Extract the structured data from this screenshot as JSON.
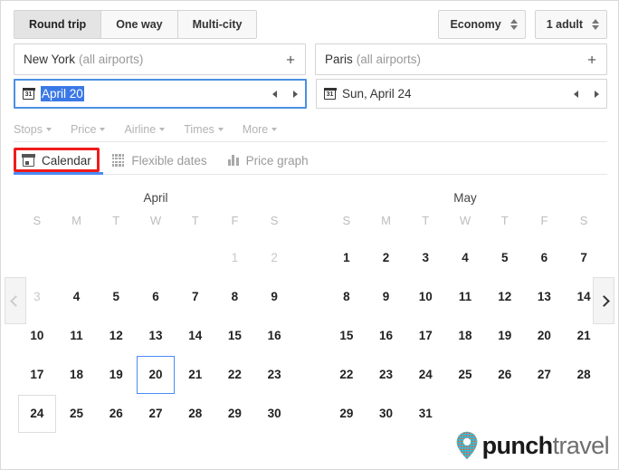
{
  "trip_types": [
    {
      "label": "Round trip",
      "active": true
    },
    {
      "label": "One way",
      "active": false
    },
    {
      "label": "Multi-city",
      "active": false
    }
  ],
  "cabin": {
    "value": "Economy"
  },
  "passengers": {
    "value": "1 adult"
  },
  "origin": {
    "city": "New York",
    "qualifier": "(all airports)",
    "add_label": "+"
  },
  "destination": {
    "city": "Paris",
    "qualifier": "(all airports)",
    "add_label": "+"
  },
  "depart_date": {
    "value": "April 20",
    "selected": true,
    "icon": "calendar-icon"
  },
  "return_date": {
    "value": "Sun, April 24",
    "selected": false,
    "icon": "calendar-icon"
  },
  "filters": [
    {
      "label": "Stops"
    },
    {
      "label": "Price"
    },
    {
      "label": "Airline"
    },
    {
      "label": "Times"
    },
    {
      "label": "More"
    }
  ],
  "view_tabs": [
    {
      "label": "Calendar",
      "icon": "calendar-icon",
      "active": true,
      "highlighted": true
    },
    {
      "label": "Flexible dates",
      "icon": "grid-icon",
      "active": false,
      "highlighted": false
    },
    {
      "label": "Price graph",
      "icon": "bar-chart-icon",
      "active": false,
      "highlighted": false
    }
  ],
  "calendar": {
    "weekdays": [
      "S",
      "M",
      "T",
      "W",
      "T",
      "F",
      "S"
    ],
    "prev_label": "‹",
    "next_label": "›",
    "prev_enabled": false,
    "next_enabled": true,
    "months": [
      {
        "name": "April",
        "lead_blanks": 5,
        "days": [
          {
            "n": 1,
            "state": "dim"
          },
          {
            "n": 2,
            "state": "dim"
          },
          {
            "n": 3,
            "state": "dim"
          },
          {
            "n": 4,
            "state": "normal"
          },
          {
            "n": 5,
            "state": "normal"
          },
          {
            "n": 6,
            "state": "normal"
          },
          {
            "n": 7,
            "state": "normal"
          },
          {
            "n": 8,
            "state": "normal"
          },
          {
            "n": 9,
            "state": "normal"
          },
          {
            "n": 10,
            "state": "normal"
          },
          {
            "n": 11,
            "state": "normal"
          },
          {
            "n": 12,
            "state": "normal"
          },
          {
            "n": 13,
            "state": "normal"
          },
          {
            "n": 14,
            "state": "normal"
          },
          {
            "n": 15,
            "state": "normal"
          },
          {
            "n": 16,
            "state": "normal"
          },
          {
            "n": 17,
            "state": "normal"
          },
          {
            "n": 18,
            "state": "normal"
          },
          {
            "n": 19,
            "state": "normal"
          },
          {
            "n": 20,
            "state": "selected"
          },
          {
            "n": 21,
            "state": "normal"
          },
          {
            "n": 22,
            "state": "normal"
          },
          {
            "n": 23,
            "state": "normal"
          },
          {
            "n": 24,
            "state": "hovered"
          },
          {
            "n": 25,
            "state": "normal"
          },
          {
            "n": 26,
            "state": "normal"
          },
          {
            "n": 27,
            "state": "normal"
          },
          {
            "n": 28,
            "state": "normal"
          },
          {
            "n": 29,
            "state": "normal"
          },
          {
            "n": 30,
            "state": "normal"
          }
        ]
      },
      {
        "name": "May",
        "lead_blanks": 0,
        "days": [
          {
            "n": 1,
            "state": "normal"
          },
          {
            "n": 2,
            "state": "normal"
          },
          {
            "n": 3,
            "state": "normal"
          },
          {
            "n": 4,
            "state": "normal"
          },
          {
            "n": 5,
            "state": "normal"
          },
          {
            "n": 6,
            "state": "normal"
          },
          {
            "n": 7,
            "state": "normal"
          },
          {
            "n": 8,
            "state": "normal"
          },
          {
            "n": 9,
            "state": "normal"
          },
          {
            "n": 10,
            "state": "normal"
          },
          {
            "n": 11,
            "state": "normal"
          },
          {
            "n": 12,
            "state": "normal"
          },
          {
            "n": 13,
            "state": "normal"
          },
          {
            "n": 14,
            "state": "normal"
          },
          {
            "n": 15,
            "state": "normal"
          },
          {
            "n": 16,
            "state": "normal"
          },
          {
            "n": 17,
            "state": "normal"
          },
          {
            "n": 18,
            "state": "normal"
          },
          {
            "n": 19,
            "state": "normal"
          },
          {
            "n": 20,
            "state": "normal"
          },
          {
            "n": 21,
            "state": "normal"
          },
          {
            "n": 22,
            "state": "normal"
          },
          {
            "n": 23,
            "state": "normal"
          },
          {
            "n": 24,
            "state": "normal"
          },
          {
            "n": 25,
            "state": "normal"
          },
          {
            "n": 26,
            "state": "normal"
          },
          {
            "n": 27,
            "state": "normal"
          },
          {
            "n": 28,
            "state": "normal"
          },
          {
            "n": 29,
            "state": "normal"
          },
          {
            "n": 30,
            "state": "normal"
          },
          {
            "n": 31,
            "state": "normal"
          }
        ]
      }
    ]
  },
  "logo": {
    "bold": "punch",
    "light": "travel"
  },
  "colors": {
    "accent_blue": "#4a8bf5",
    "selection_blue": "#3b78e7",
    "annotation_red": "#ee1c1c",
    "text_dark": "#222222",
    "text_muted": "#9a9a9a"
  }
}
